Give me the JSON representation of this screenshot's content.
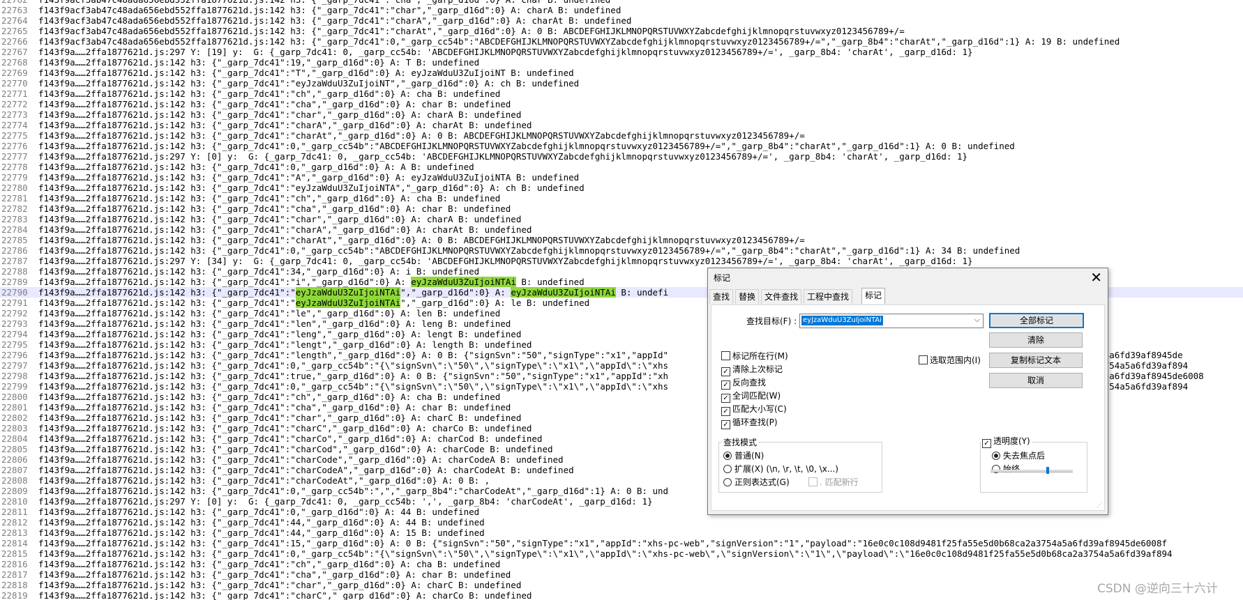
{
  "editor": {
    "lines": [
      {
        "n": "22762",
        "t": "f143f9acf3ab47c48ada656ebd552ffa1877621d.js:142 h3: {\"_garp_7dc41\":\"cha\",\"_garp_d16d\":0} A: char B: undefined"
      },
      {
        "n": "22763",
        "t": "f143f9acf3ab47c48ada656ebd552ffa1877621d.js:142 h3: {\"_garp_7dc41\":\"char\",\"_garp_d16d\":0} A: charA B: undefined"
      },
      {
        "n": "22764",
        "t": "f143f9acf3ab47c48ada656ebd552ffa1877621d.js:142 h3: {\"_garp_7dc41\":\"charA\",\"_garp_d16d\":0} A: charAt B: undefined"
      },
      {
        "n": "22765",
        "t": "f143f9acf3ab47c48ada656ebd552ffa1877621d.js:142 h3: {\"_garp_7dc41\":\"charAt\",\"_garp_d16d\":0} A: 0 B: ABCDEFGHIJKLMNOPQRSTUVWXYZabcdefghijklmnopqrstuvwxyz0123456789+/="
      },
      {
        "n": "22766",
        "t": "f143f9acf3ab47c48ada656ebd552ffa1877621d.js:142 h3: {\"_garp_7dc41\":0,\"_garp_cc54b\":\"ABCDEFGHIJKLMNOPQRSTUVWXYZabcdefghijklmnopqrstuvwxyz0123456789+/=\",\"_garp_8b4\":\"charAt\",\"_garp_d16d\":1} A: 19 B: undefined"
      },
      {
        "n": "22767",
        "t": "f143f9a……2ffa1877621d.js:297 Y: [19] y:  G: {_garp_7dc41: 0, _garp_cc54b: 'ABCDEFGHIJKLMNOPQRSTUVWXYZabcdefghijklmnopqrstuvwxyz0123456789+/=', _garp_8b4: 'charAt', _garp_d16d: 1}"
      },
      {
        "n": "22768",
        "t": "f143f9a……2ffa1877621d.js:142 h3: {\"_garp_7dc41\":19,\"_garp_d16d\":0} A: T B: undefined"
      },
      {
        "n": "22769",
        "t": "f143f9a……2ffa1877621d.js:142 h3: {\"_garp_7dc41\":\"T\",\"_garp_d16d\":0} A: eyJzaWduU3ZuIjoiNT B: undefined"
      },
      {
        "n": "22770",
        "t": "f143f9a……2ffa1877621d.js:142 h3: {\"_garp_7dc41\":\"eyJzaWduU3ZuIjoiNT\",\"_garp_d16d\":0} A: ch B: undefined"
      },
      {
        "n": "22771",
        "t": "f143f9a……2ffa1877621d.js:142 h3: {\"_garp_7dc41\":\"ch\",\"_garp_d16d\":0} A: cha B: undefined"
      },
      {
        "n": "22772",
        "t": "f143f9a……2ffa1877621d.js:142 h3: {\"_garp_7dc41\":\"cha\",\"_garp_d16d\":0} A: char B: undefined"
      },
      {
        "n": "22773",
        "t": "f143f9a……2ffa1877621d.js:142 h3: {\"_garp_7dc41\":\"char\",\"_garp_d16d\":0} A: charA B: undefined"
      },
      {
        "n": "22774",
        "t": "f143f9a……2ffa1877621d.js:142 h3: {\"_garp_7dc41\":\"charA\",\"_garp_d16d\":0} A: charAt B: undefined"
      },
      {
        "n": "22775",
        "t": "f143f9a……2ffa1877621d.js:142 h3: {\"_garp_7dc41\":\"charAt\",\"_garp_d16d\":0} A: 0 B: ABCDEFGHIJKLMNOPQRSTUVWXYZabcdefghijklmnopqrstuvwxyz0123456789+/="
      },
      {
        "n": "22776",
        "t": "f143f9a……2ffa1877621d.js:142 h3: {\"_garp_7dc41\":0,\"_garp_cc54b\":\"ABCDEFGHIJKLMNOPQRSTUVWXYZabcdefghijklmnopqrstuvwxyz0123456789+/=\",\"_garp_8b4\":\"charAt\",\"_garp_d16d\":1} A: 0 B: undefined"
      },
      {
        "n": "22777",
        "t": "f143f9a……2ffa1877621d.js:297 Y: [0] y:  G: {_garp_7dc41: 0, _garp_cc54b: 'ABCDEFGHIJKLMNOPQRSTUVWXYZabcdefghijklmnopqrstuvwxyz0123456789+/=', _garp_8b4: 'charAt', _garp_d16d: 1}"
      },
      {
        "n": "22778",
        "t": "f143f9a……2ffa1877621d.js:142 h3: {\"_garp_7dc41\":0,\"_garp_d16d\":0} A: A B: undefined"
      },
      {
        "n": "22779",
        "t": "f143f9a……2ffa1877621d.js:142 h3: {\"_garp_7dc41\":\"A\",\"_garp_d16d\":0} A: eyJzaWduU3ZuIjoiNTA B: undefined"
      },
      {
        "n": "22780",
        "t": "f143f9a……2ffa1877621d.js:142 h3: {\"_garp_7dc41\":\"eyJzaWduU3ZuIjoiNTA\",\"_garp_d16d\":0} A: ch B: undefined"
      },
      {
        "n": "22781",
        "t": "f143f9a……2ffa1877621d.js:142 h3: {\"_garp_7dc41\":\"ch\",\"_garp_d16d\":0} A: cha B: undefined"
      },
      {
        "n": "22782",
        "t": "f143f9a……2ffa1877621d.js:142 h3: {\"_garp_7dc41\":\"cha\",\"_garp_d16d\":0} A: char B: undefined"
      },
      {
        "n": "22783",
        "t": "f143f9a……2ffa1877621d.js:142 h3: {\"_garp_7dc41\":\"char\",\"_garp_d16d\":0} A: charA B: undefined"
      },
      {
        "n": "22784",
        "t": "f143f9a……2ffa1877621d.js:142 h3: {\"_garp_7dc41\":\"charA\",\"_garp_d16d\":0} A: charAt B: undefined"
      },
      {
        "n": "22785",
        "t": "f143f9a……2ffa1877621d.js:142 h3: {\"_garp_7dc41\":\"charAt\",\"_garp_d16d\":0} A: 0 B: ABCDEFGHIJKLMNOPQRSTUVWXYZabcdefghijklmnopqrstuvwxyz0123456789+/="
      },
      {
        "n": "22786",
        "t": "f143f9a……2ffa1877621d.js:142 h3: {\"_garp_7dc41\":0,\"_garp_cc54b\":\"ABCDEFGHIJKLMNOPQRSTUVWXYZabcdefghijklmnopqrstuvwxyz0123456789+/=\",\"_garp_8b4\":\"charAt\",\"_garp_d16d\":1} A: 34 B: undefined"
      },
      {
        "n": "22787",
        "t": "f143f9a……2ffa1877621d.js:297 Y: [34] y:  G: {_garp_7dc41: 0, _garp_cc54b: 'ABCDEFGHIJKLMNOPQRSTUVWXYZabcdefghijklmnopqrstuvwxyz0123456789+/=', _garp_8b4: 'charAt', _garp_d16d: 1}"
      },
      {
        "n": "22788",
        "t": "f143f9a……2ffa1877621d.js:142 h3: {\"_garp_7dc41\":34,\"_garp_d16d\":0} A: i B: undefined"
      },
      {
        "n": "22789",
        "t": "f143f9a……2ffa1877621d.js:142 h3: {\"_garp_7dc41\":\"i\",\"_garp_d16d\":0} A: ",
        "hl": "eyJzaWduU3ZuIjoiNTAi",
        "t2": " B: undefined"
      },
      {
        "n": "22790",
        "t": "f143f9a……2ffa1877621d.js:142 h3: {\"_garp_7dc41\":\"",
        "hl": "eyJzaWduU3ZuIjoiNTAi",
        "t2": "\",\"_garp_d16d\":0} A: ",
        "hl2": "eyJzaWduU3ZuIjoiNTAi",
        "t3": " B: undefi"
      },
      {
        "n": "22791",
        "t": "f143f9a……2ffa1877621d.js:142 h3: {\"_garp_7dc41\":\"",
        "hl": "eyJzaWduU3ZuIjoiNTAi",
        "t2": "\",\"_garp_d16d\":0} A: le B: undefined"
      },
      {
        "n": "22792",
        "t": "f143f9a……2ffa1877621d.js:142 h3: {\"_garp_7dc41\":\"le\",\"_garp_d16d\":0} A: len B: undefined"
      },
      {
        "n": "22793",
        "t": "f143f9a……2ffa1877621d.js:142 h3: {\"_garp_7dc41\":\"len\",\"_garp_d16d\":0} A: leng B: undefined"
      },
      {
        "n": "22794",
        "t": "f143f9a……2ffa1877621d.js:142 h3: {\"_garp_7dc41\":\"leng\",\"_garp_d16d\":0} A: lengt B: undefined"
      },
      {
        "n": "22795",
        "t": "f143f9a……2ffa1877621d.js:142 h3: {\"_garp_7dc41\":\"lengt\",\"_garp_d16d\":0} A: length B: undefined"
      },
      {
        "n": "22796",
        "t": "f143f9a……2ffa1877621d.js:142 h3: {\"_garp_7dc41\":\"length\",\"_garp_d16d\":0} A: 0 B: {\"signSvn\":\"50\",\"signType\":\"x1\",\"appId\"                                                                          ca2a3754a5a6fd39af8945de"
      },
      {
        "n": "22797",
        "t": "f143f9a……2ffa1877621d.js:142 h3: {\"_garp_7dc41\":0,\"_garp_cc54b\":\"{\\\"signSvn\\\":\\\"50\\\",\\\"signType\\\":\\\"x1\\\",\\\"appId\\\":\\\"xhs                                                                          0b68ca2a3754a5a6fd39af894"
      },
      {
        "n": "22798",
        "t": "f143f9a……2ffa1877621d.js:142 h3: {\"_garp_7dc41\":true,\"_garp_d16d\":0} A: 0 B: {\"signSvn\":\"50\",\"signType\":\"x1\",\"appId\":\"xh                                                                          ca2a3754a5a6fd39af8945de6008"
      },
      {
        "n": "22799",
        "t": "f143f9a……2ffa1877621d.js:142 h3: {\"_garp_7dc41\":0,\"_garp_cc54b\":\"{\\\"signSvn\\\":\\\"50\\\",\\\"signType\\\":\\\"x1\\\",\\\"appId\\\":\\\"xhs                                                                          0b68ca2a3754a5a6fd39af894"
      },
      {
        "n": "22800",
        "t": "f143f9a……2ffa1877621d.js:142 h3: {\"_garp_7dc41\":\"ch\",\"_garp_d16d\":0} A: cha B: undefined"
      },
      {
        "n": "22801",
        "t": "f143f9a……2ffa1877621d.js:142 h3: {\"_garp_7dc41\":\"cha\",\"_garp_d16d\":0} A: char B: undefined"
      },
      {
        "n": "22802",
        "t": "f143f9a……2ffa1877621d.js:142 h3: {\"_garp_7dc41\":\"char\",\"_garp_d16d\":0} A: charC B: undefined"
      },
      {
        "n": "22803",
        "t": "f143f9a……2ffa1877621d.js:142 h3: {\"_garp_7dc41\":\"charC\",\"_garp_d16d\":0} A: charCo B: undefined"
      },
      {
        "n": "22804",
        "t": "f143f9a……2ffa1877621d.js:142 h3: {\"_garp_7dc41\":\"charCo\",\"_garp_d16d\":0} A: charCod B: undefined"
      },
      {
        "n": "22805",
        "t": "f143f9a……2ffa1877621d.js:142 h3: {\"_garp_7dc41\":\"charCod\",\"_garp_d16d\":0} A: charCode B: undefined"
      },
      {
        "n": "22806",
        "t": "f143f9a……2ffa1877621d.js:142 h3: {\"_garp_7dc41\":\"charCode\",\"_garp_d16d\":0} A: charCodeA B: undefined"
      },
      {
        "n": "22807",
        "t": "f143f9a……2ffa1877621d.js:142 h3: {\"_garp_7dc41\":\"charCodeA\",\"_garp_d16d\":0} A: charCodeAt B: undefined"
      },
      {
        "n": "22808",
        "t": "f143f9a……2ffa1877621d.js:142 h3: {\"_garp_7dc41\":\"charCodeAt\",\"_garp_d16d\":0} A: 0 B: ,"
      },
      {
        "n": "22809",
        "t": "f143f9a……2ffa1877621d.js:142 h3: {\"_garp_7dc41\":0,\"_garp_cc54b\":\",\",\"_garp_8b4\":\"charCodeAt\",\"_garp_d16d\":1} A: 0 B: und"
      },
      {
        "n": "22810",
        "t": "f143f9a……2ffa1877621d.js:297 Y: [0] y:  G: {_garp_7dc41: 0, _garp_cc54b: ',', _garp_8b4: 'charCodeAt', _garp_d16d: 1}"
      },
      {
        "n": "22811",
        "t": "f143f9a……2ffa1877621d.js:142 h3: {\"_garp_7dc41\":0,\"_garp_d16d\":0} A: 44 B: undefined"
      },
      {
        "n": "22812",
        "t": "f143f9a……2ffa1877621d.js:142 h3: {\"_garp_7dc41\":44,\"_garp_d16d\":0} A: 44 B: undefined"
      },
      {
        "n": "22813",
        "t": "f143f9a……2ffa1877621d.js:142 h3: {\"_garp_7dc41\":44,\"_garp_d16d\":0} A: 15 B: undefined"
      },
      {
        "n": "22814",
        "t": "f143f9a……2ffa1877621d.js:142 h3: {\"_garp_7dc41\":15,\"_garp_d16d\":0} A: 0 B: {\"signSvn\":\"50\",\"signType\":\"x1\",\"appId\":\"xhs-pc-web\",\"signVersion\":\"1\",\"payload\":\"16e0c0c108d9481f25fa55e5d0b68ca2a3754a5a6fd39af8945de6008f"
      },
      {
        "n": "22815",
        "t": "f143f9a……2ffa1877621d.js:142 h3: {\"_garp_7dc41\":0,\"_garp_cc54b\":\"{\\\"signSvn\\\":\\\"50\\\",\\\"signType\\\":\\\"x1\\\",\\\"appId\\\":\\\"xhs-pc-web\\\",\\\"signVersion\\\":\\\"1\\\",\\\"payload\\\":\\\"16e0c0c108d9481f25fa55e5d0b68ca2a3754a5a6fd39af894"
      },
      {
        "n": "22816",
        "t": "f143f9a……2ffa1877621d.js:142 h3: {\"_garp_7dc41\":\"ch\",\"_garp_d16d\":0} A: cha B: undefined"
      },
      {
        "n": "22817",
        "t": "f143f9a……2ffa1877621d.js:142 h3: {\"_garp_7dc41\":\"cha\",\"_garp_d16d\":0} A: char B: undefined"
      },
      {
        "n": "22818",
        "t": "f143f9a……2ffa1877621d.js:142 h3: {\"_garp_7dc41\":\"char\",\"_garp_d16d\":0} A: charC B: undefined"
      },
      {
        "n": "22819",
        "t": "f143f9a……2ffa1877621d.js:142 h3: {\"_garp_7dc41\":\"charC\",\"_garp_d16d\":0} A: charCo B: undefined"
      }
    ],
    "highlight_color": "#8fd839"
  },
  "dialog": {
    "title": "标记",
    "close": "✕",
    "tabs": [
      "查找",
      "替换",
      "文件查找",
      "工程中查找",
      "标记"
    ],
    "active_tab": "标记",
    "find_label": "查找目标(F) :",
    "find_value": "eyJzaWduU3ZuIjoiNTAi",
    "buttons": {
      "mark_all": "全部标记",
      "clear": "清除",
      "copy_marked": "复制标记文本",
      "cancel": "取消"
    },
    "options": {
      "bookmark_line": {
        "label": "标记所在行(M)",
        "checked": false
      },
      "purge": {
        "label": "清除上次标记",
        "checked": true
      },
      "backward": {
        "label": "反向查找",
        "checked": true
      },
      "whole_word": {
        "label": "全词匹配(W)",
        "checked": true
      },
      "match_case": {
        "label": "匹配大小写(C)",
        "checked": true
      },
      "wrap": {
        "label": "循环查找(P)",
        "checked": true
      },
      "in_selection": {
        "label": "选取范围内(I)",
        "checked": false
      }
    },
    "search_mode": {
      "title": "查找模式",
      "normal": "普通(N)",
      "extended": "扩展(X) (\\n, \\r, \\t, \\0, \\x...)",
      "regex": "正则表达式(G)",
      "dot_newline": ". 匹配新行",
      "selected": "normal"
    },
    "transparency": {
      "title": "透明度(Y)",
      "checked": true,
      "on_lose_focus": "失去焦点后",
      "always": "始终",
      "selected": "on_lose_focus",
      "level": 0.7
    }
  },
  "watermark": "CSDN @逆向三十六计"
}
